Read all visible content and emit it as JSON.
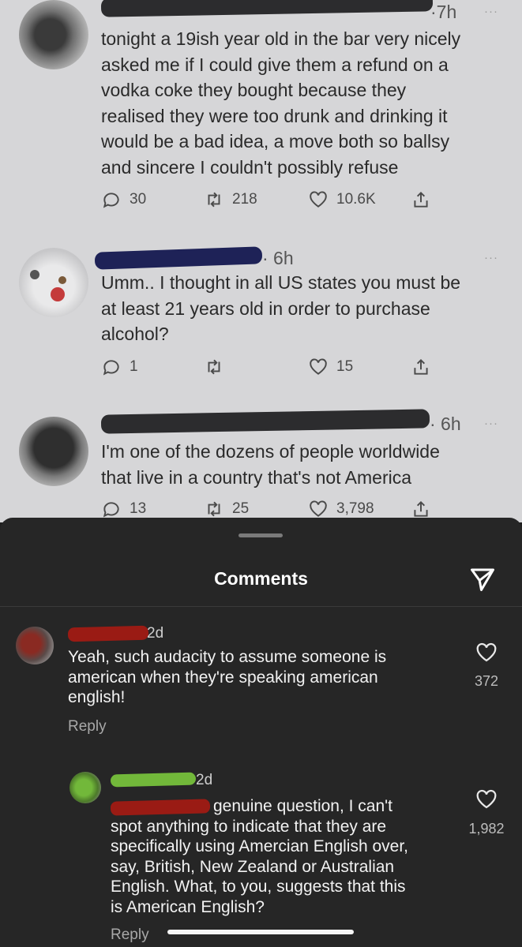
{
  "tweets": [
    {
      "time_suffix": "·7h",
      "more": "···",
      "lines": [
        "tonight a 19ish year old in the bar very nicely",
        "asked me if I could give them a refund on a",
        "vodka coke they bought because they",
        "realised they were too drunk and drinking it",
        "would be a bad idea, a move both so ballsy",
        "and sincere I couldn't possibly refuse"
      ],
      "replies": "30",
      "retweets": "218",
      "likes": "10.6K"
    },
    {
      "time_suffix": "· 6h",
      "more": "···",
      "lines": [
        "Umm.. I thought in all US states you must be",
        "at least 21 years old in order to purchase",
        "alcohol?"
      ],
      "replies": "1",
      "retweets": "",
      "likes": "15"
    },
    {
      "time_suffix": "· 6h",
      "more": "···",
      "lines": [
        "I'm one of the dozens of people worldwide",
        "that live in a country that's not America"
      ],
      "replies": "13",
      "retweets": "25",
      "likes": "3,798"
    }
  ],
  "sheet": {
    "title": "Comments"
  },
  "comments": [
    {
      "time": "2d",
      "lines": [
        "Yeah, such audacity to assume someone is",
        "american when they're speaking american",
        "english!"
      ],
      "reply_label": "Reply",
      "like_count": "372"
    },
    {
      "time": "2d",
      "lines": [
        "genuine question, I can't",
        "spot anything to indicate that they are",
        "specifically using Amercian English over,",
        "say, British, New Zealand or Australian",
        "English. What, to you, suggests that this",
        "is American English?"
      ],
      "reply_label": "Reply",
      "like_count": "1,982"
    }
  ],
  "colors": {
    "sheet_bg": "#262626",
    "tweet_bg": "#d6d6d8",
    "redaction_red": "#9a1b14",
    "redaction_green": "#72b83a",
    "redaction_navy": "#1e2257"
  }
}
